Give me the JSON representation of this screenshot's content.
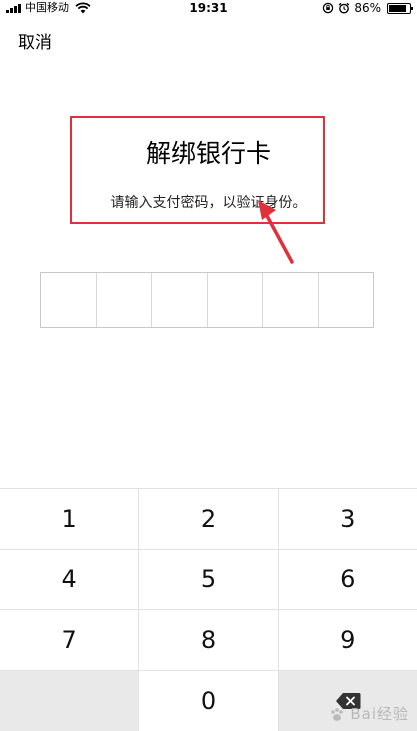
{
  "status_bar": {
    "carrier": "中国移动",
    "time": "19:31",
    "battery": "86%",
    "battery_level": 0.86,
    "icons": [
      "signal-icon",
      "wifi-icon",
      "rotation-lock-icon",
      "alarm-icon",
      "battery-icon"
    ]
  },
  "nav": {
    "cancel_label": "取消"
  },
  "header": {
    "title": "解绑银行卡",
    "subtitle": "请输入支付密码，以验证身份。"
  },
  "password": {
    "length": 6
  },
  "keypad": {
    "rows": [
      [
        "1",
        "2",
        "3"
      ],
      [
        "4",
        "5",
        "6"
      ],
      [
        "7",
        "8",
        "9"
      ],
      [
        "",
        "0",
        "delete-icon"
      ]
    ]
  },
  "watermark": {
    "text": "Bai经验"
  },
  "colors": {
    "annotation_red": "#e0303a",
    "key_dim": "#e9e9e9",
    "border": "#e2e2e2"
  }
}
